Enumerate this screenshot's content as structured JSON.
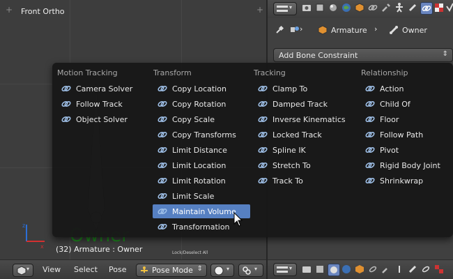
{
  "viewport": {
    "view_label": "Front Ortho",
    "object_text": "Owner",
    "status_text": "(32) Armature : Owner",
    "tip_text": "Lock/Deselect All"
  },
  "header": {
    "menus": [
      "View",
      "Select",
      "Pose"
    ],
    "mode_label": "Pose Mode"
  },
  "properties": {
    "breadcrumb": [
      "Armature",
      "Owner"
    ],
    "add_constraint_label": "Add Bone Constraint"
  },
  "menu": {
    "columns": [
      {
        "title": "Motion Tracking",
        "items": [
          "Camera Solver",
          "Follow Track",
          "Object Solver"
        ]
      },
      {
        "title": "Transform",
        "items": [
          "Copy Location",
          "Copy Rotation",
          "Copy Scale",
          "Copy Transforms",
          "Limit Distance",
          "Limit Location",
          "Limit Rotation",
          "Limit Scale",
          "Maintain Volume",
          "Transformation"
        ]
      },
      {
        "title": "Tracking",
        "items": [
          "Clamp To",
          "Damped Track",
          "Inverse Kinematics",
          "Locked Track",
          "Spline IK",
          "Stretch To",
          "Track To"
        ]
      },
      {
        "title": "Relationship",
        "items": [
          "Action",
          "Child Of",
          "Floor",
          "Follow Path",
          "Pivot",
          "Rigid Body Joint",
          "Shrinkwrap"
        ]
      }
    ],
    "highlighted": "Maintain Volume"
  },
  "colors": {
    "highlight": "#5680c2",
    "active_tab": "#6a86c0",
    "menu_bg": "#181818",
    "object_green": "#1f8a1f"
  }
}
